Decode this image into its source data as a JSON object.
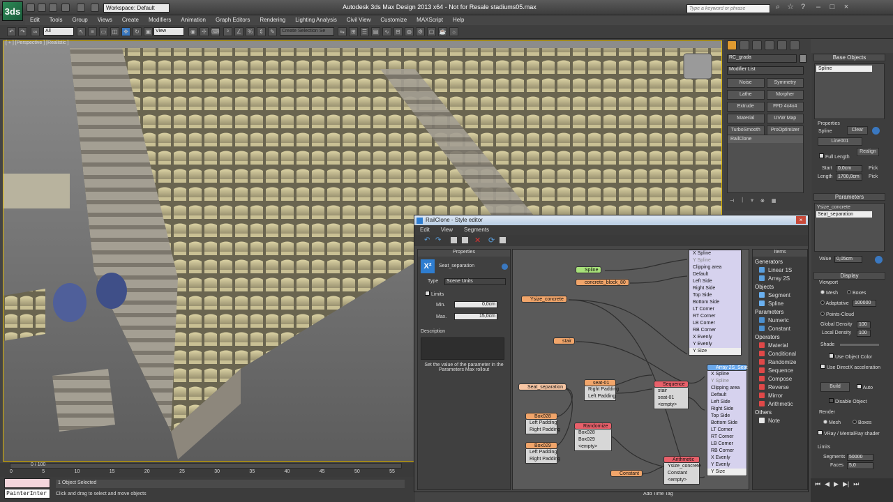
{
  "app": {
    "logo": "3ds",
    "workspace": "Workspace: Default",
    "window_title": "Autodesk 3ds Max Design 2013 x64  -  Not for Resale    stadiums05.max",
    "search_placeholder": "Type a keyword or phrase"
  },
  "menu": [
    "Edit",
    "Tools",
    "Group",
    "Views",
    "Create",
    "Modifiers",
    "Animation",
    "Graph Editors",
    "Rendering",
    "Lighting Analysis",
    "Civil View",
    "Customize",
    "MAXScript",
    "Help"
  ],
  "toolbar": {
    "filter": "All",
    "view": "View",
    "selection_set": "Create Selection Se"
  },
  "viewport": {
    "label": "[ + ] [Perspective ] [Realistic ]"
  },
  "command_panel": {
    "object_name": "RC_grada",
    "modifier_list": "Modifier List",
    "modifiers": [
      "Noise",
      "Symmetry",
      "Lathe",
      "Morpher",
      "Extrude",
      "FFD 4x4x4",
      "Material",
      "UVW Map",
      "TurboSmooth",
      "ProOptimizer"
    ],
    "stack_item": "RailClone"
  },
  "right_panel": {
    "base_objects_title": "Base Objects",
    "base_item": "Spline",
    "properties_label": "Properties",
    "spline_label": "Spline",
    "clear": "Clear",
    "spline_value": "Line001",
    "realign": "Realign",
    "full_length": "Full Length",
    "start_label": "Start",
    "start_value": "0,0cm",
    "length_label": "Length",
    "length_value": "1700,0cm",
    "pick": "Pick",
    "parameters_title": "Parameters",
    "param_1": "Ysize_concrete",
    "param_2": "Seat_separation",
    "value_label": "Value",
    "value_value": "0,05cm",
    "display_title": "Display",
    "viewport_label": "Viewport",
    "mesh": "Mesh",
    "boxes": "Boxes",
    "adaptative": "Adaptative",
    "adaptative_value": "100000",
    "points_cloud": "Points-Cloud",
    "global_density": "Global Density",
    "global_density_value": "100",
    "local_density": "Local Density",
    "local_density_value": "100",
    "shade": "Shade",
    "use_object_color": "Use Object Color",
    "use_directx": "Use DirectX acceleration",
    "build": "Build",
    "auto": "Auto",
    "disable_object": "Disable Object",
    "render_label": "Render",
    "vray": "VRay / MentalRay shader",
    "limits_label": "Limits",
    "segments_label": "Segments",
    "segments_value": "50000",
    "faces_label": "Faces",
    "faces_value": "5,0"
  },
  "timeline": {
    "frame": "0 / 100",
    "ticks": [
      "0",
      "5",
      "10",
      "15",
      "20",
      "25",
      "30",
      "35",
      "40",
      "45",
      "50",
      "55"
    ]
  },
  "status": {
    "script": "PainterInter",
    "selected": "1 Object Selected",
    "prompt": "Click and drag to select and move objects",
    "add_time_tag": "Add Time Tag"
  },
  "style_editor": {
    "title": "RailClone - Style editor",
    "menu": [
      "Edit",
      "View",
      "Segments"
    ],
    "properties_title": "Properties",
    "param_name": "Seat_separation",
    "type_label": "Type",
    "type_value": "Scene Units",
    "limits": "Limits",
    "min_label": "Min.",
    "min_value": "0,0cm",
    "max_label": "Max.",
    "max_value": "15,0cm",
    "description_label": "Description",
    "hint": "Set the value of the parameter in the Parameters Max rollout",
    "items_title": "Items",
    "items": [
      {
        "label": "Generators",
        "cat": true
      },
      {
        "label": "Linear 1S",
        "color": "#5aa0e0"
      },
      {
        "label": "Array 2S",
        "color": "#5aa0e0"
      },
      {
        "label": "Objects",
        "cat": true
      },
      {
        "label": "Segment",
        "color": "#6ab0f0"
      },
      {
        "label": "Spline",
        "color": "#6ab0f0"
      },
      {
        "label": "Parameters",
        "cat": true
      },
      {
        "label": "Numeric",
        "color": "#4b90d0"
      },
      {
        "label": "Constant",
        "color": "#4b90d0"
      },
      {
        "label": "Operators",
        "cat": true
      },
      {
        "label": "Material",
        "color": "#e04848"
      },
      {
        "label": "Conditional",
        "color": "#e04848"
      },
      {
        "label": "Randomize",
        "color": "#e04848"
      },
      {
        "label": "Sequence",
        "color": "#e04848"
      },
      {
        "label": "Compose",
        "color": "#e04848"
      },
      {
        "label": "Reverse",
        "color": "#e04848"
      },
      {
        "label": "Mirror",
        "color": "#e04848"
      },
      {
        "label": "Arithmetic",
        "color": "#e04848"
      },
      {
        "label": "Others",
        "cat": true
      },
      {
        "label": "Note",
        "color": "#e8e8e8"
      }
    ],
    "nodes": {
      "spline": "Spline",
      "concrete": "concrete_block_80",
      "ysize": "Ysize_concrete",
      "stair": "stair",
      "seat_sep": "Seat_separation",
      "seat01": "seat-01",
      "seat01_rows": [
        "Right Padding",
        "Left Padding"
      ],
      "sequence": "Sequence",
      "sequence_rows": [
        "stair",
        "seat-01",
        "<empty>"
      ],
      "box028": "Box028",
      "box029": "Box029",
      "box_rows": [
        "Left Padding",
        "Right Padding"
      ],
      "randomize": "Randomize",
      "randomize_rows": [
        "Box028",
        "Box029",
        "<empty>"
      ],
      "constant": "Constant",
      "arithmetic": "Arithmetic",
      "arithmetic_rows": [
        "Ysize_concrete",
        "Constant",
        "<empty>"
      ],
      "gen1_rows": [
        "X Spline",
        "Y Spline",
        "Clipping area",
        "Default",
        "Left Side",
        "Right Side",
        "Top Side",
        "Bottom Side",
        "LT Corner",
        "RT Corner",
        "LB Corner",
        "RB Corner",
        "X Evenly",
        "Y Evenly",
        "Y Size"
      ],
      "gen2": "Array 2S_Seat",
      "gen2_rows": [
        "X Spline",
        "Y Spline",
        "Clipping area",
        "Default",
        "Left Side",
        "Right Side",
        "Top Side",
        "Bottom Side",
        "LT Corner",
        "RT Corner",
        "LB Corner",
        "RB Corner",
        "X Evenly",
        "Y Evenly",
        "Y Size"
      ]
    }
  }
}
